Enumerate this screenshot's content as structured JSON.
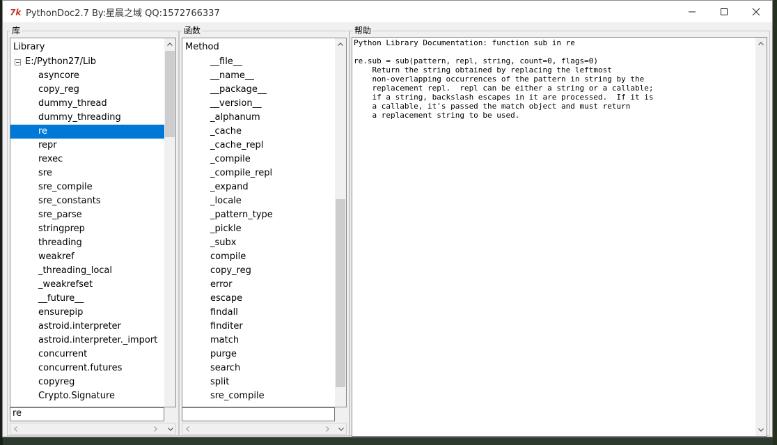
{
  "window": {
    "title": "PythonDoc2.7 By:星晨之域 QQ:1572766337"
  },
  "library_panel": {
    "label": "库",
    "header": "Library",
    "root": "E:/Python27/Lib",
    "items": [
      "asyncore",
      "copy_reg",
      "dummy_thread",
      "dummy_threading",
      "re",
      "repr",
      "rexec",
      "sre",
      "sre_compile",
      "sre_constants",
      "sre_parse",
      "stringprep",
      "threading",
      "weakref",
      "_threading_local",
      "_weakrefset",
      "__future__",
      "ensurepip",
      "astroid.interpreter",
      "astroid.interpreter._import",
      "concurrent",
      "concurrent.futures",
      "copyreg",
      "Crypto.Signature"
    ],
    "selected": "re",
    "search_value": "re"
  },
  "function_panel": {
    "label": "函数",
    "header": "Method",
    "items": [
      "__file__",
      "__name__",
      "__package__",
      "__version__",
      "_alphanum",
      "_cache",
      "_cache_repl",
      "_compile",
      "_compile_repl",
      "_expand",
      "_locale",
      "_pattern_type",
      "_pickle",
      "_subx",
      "compile",
      "copy_reg",
      "error",
      "escape",
      "findall",
      "finditer",
      "match",
      "purge",
      "search",
      "split",
      "sre_compile"
    ],
    "search_value": ""
  },
  "help_panel": {
    "label": "帮助",
    "text": "Python Library Documentation: function sub in re\n\nre.sub = sub(pattern, repl, string, count=0, flags=0)\n    Return the string obtained by replacing the leftmost\n    non-overlapping occurrences of the pattern in string by the\n    replacement repl.  repl can be either a string or a callable;\n    if a string, backslash escapes in it are processed.  If it is\n    a callable, it's passed the match object and must return\n    a replacement string to be used."
  },
  "scroll": {
    "library_position": 0.0,
    "function_position": 0.42
  },
  "colors": {
    "selection": "#0078d7",
    "icon_red": "#c0392b"
  }
}
